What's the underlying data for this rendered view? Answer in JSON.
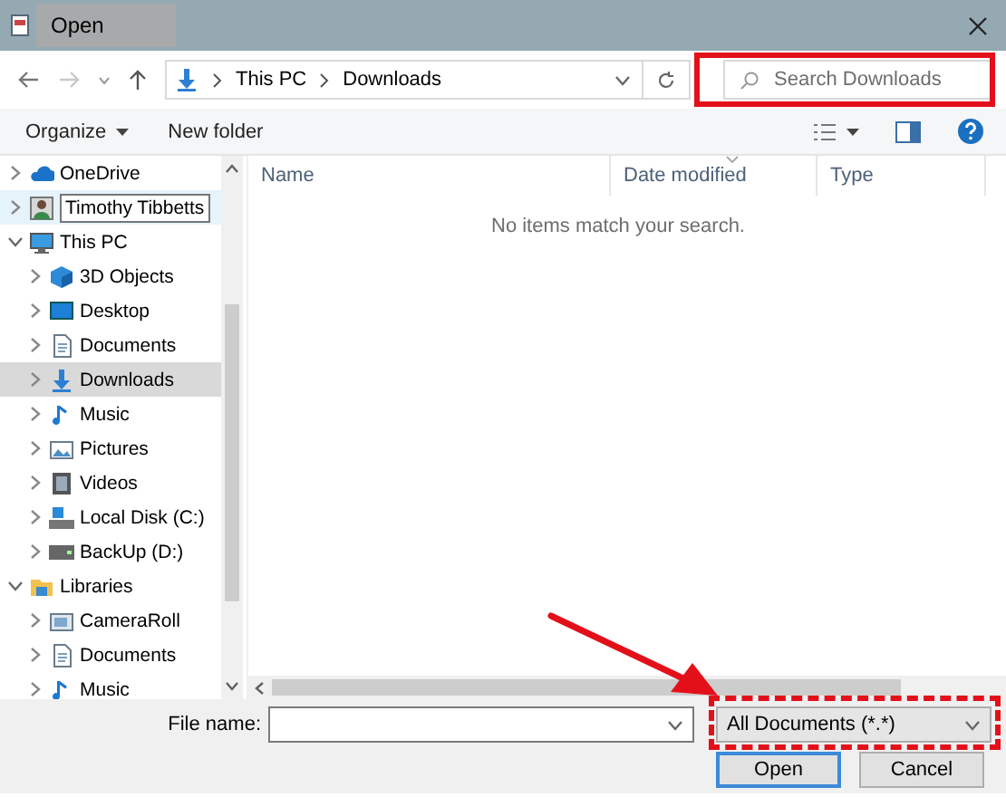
{
  "window": {
    "title": "Open"
  },
  "nav": {
    "path": [
      "This PC",
      "Downloads"
    ],
    "search": {
      "placeholder": "Search Downloads"
    }
  },
  "toolbar": {
    "buttons": [
      "Organize",
      "New folder"
    ]
  },
  "tree": [
    {
      "label": "OneDrive",
      "expanded": false,
      "selected": false,
      "hovered": false
    },
    {
      "label": "Timothy Tibbetts",
      "expanded": false,
      "selected": false,
      "hovered": true
    },
    {
      "label": "This PC",
      "expanded": true,
      "selected": false,
      "hovered": false,
      "children": [
        {
          "label": "3D Objects",
          "expanded": false,
          "selected": false,
          "hovered": false
        },
        {
          "label": "Desktop",
          "expanded": false,
          "selected": false,
          "hovered": false
        },
        {
          "label": "Documents",
          "expanded": false,
          "selected": false,
          "hovered": false
        },
        {
          "label": "Downloads",
          "expanded": false,
          "selected": true,
          "hovered": false
        },
        {
          "label": "Music",
          "expanded": false,
          "selected": false,
          "hovered": false
        },
        {
          "label": "Pictures",
          "expanded": false,
          "selected": false,
          "hovered": false
        },
        {
          "label": "Videos",
          "expanded": false,
          "selected": false,
          "hovered": false
        },
        {
          "label": "Local Disk (C:)",
          "expanded": false,
          "selected": false,
          "hovered": false
        },
        {
          "label": "BackUp (D:)",
          "expanded": false,
          "selected": false,
          "hovered": false
        }
      ]
    },
    {
      "label": "Libraries",
      "expanded": true,
      "selected": false,
      "hovered": false,
      "children": [
        {
          "label": "CameraRoll",
          "expanded": false,
          "selected": false,
          "hovered": false
        },
        {
          "label": "Documents",
          "expanded": false,
          "selected": false,
          "hovered": false
        },
        {
          "label": "Music",
          "expanded": false,
          "selected": false,
          "hovered": false
        }
      ]
    }
  ],
  "file_list": {
    "columns": [
      "Name",
      "Date modified",
      "Type"
    ],
    "empty_message": "No items match your search."
  },
  "footer": {
    "file_name": {
      "label": "File name:"
    },
    "file_type": {
      "value": "All Documents (*.*)"
    },
    "buttons": [
      {
        "label": "Open",
        "default": true
      },
      {
        "label": "Cancel",
        "default": false
      }
    ]
  }
}
